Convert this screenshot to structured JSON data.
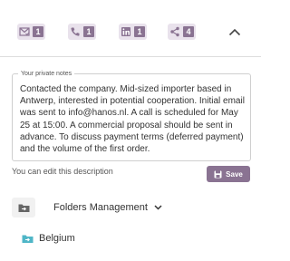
{
  "toolbar": {
    "counters": [
      {
        "icon": "email-icon",
        "count": "1"
      },
      {
        "icon": "phone-icon",
        "count": "1"
      },
      {
        "icon": "linkedin-icon",
        "count": "1"
      },
      {
        "icon": "share-icon",
        "count": "4"
      }
    ],
    "collapse_icon": "chevron-up-icon"
  },
  "notes": {
    "legend": "Your private notes",
    "text": "Contacted the company. Mid-sized importer based in Antwerp, interested in potential cooperation. Initial email was sent to info@hanos.nl. A call is scheduled for May 25 at 15:00. A commercial proposal should be sent in advance. To discuss payment terms (deferred payment) and the volume of the first order.",
    "edit_hint": "You can edit this description",
    "save_label": "Save"
  },
  "folders": {
    "label": "Folders Management",
    "items": [
      {
        "name": "Belgium"
      }
    ]
  },
  "colors": {
    "accent": "#8a7392",
    "accent_light": "#e9e2ec",
    "folder_teal": "#4fb6c7"
  }
}
